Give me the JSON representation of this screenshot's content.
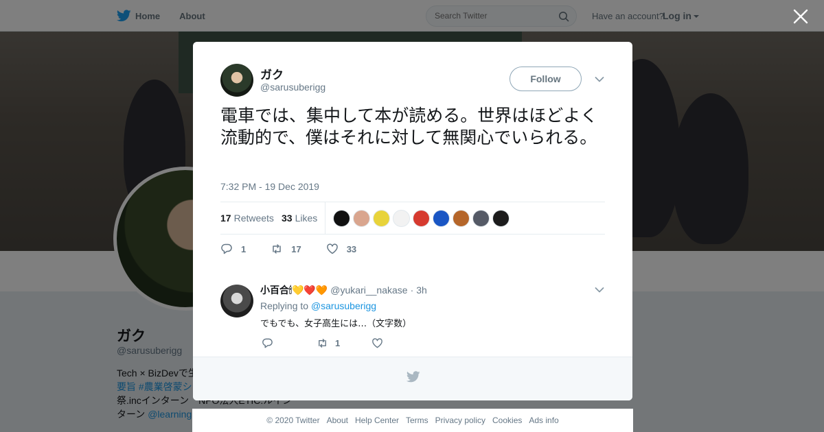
{
  "nav": {
    "home_label": "Home",
    "about_label": "About",
    "search_placeholder": "Search Twitter",
    "have_account": "Have an account?",
    "login_label": "Log in"
  },
  "profile": {
    "name": "ガク",
    "handle": "@sarusuberigg",
    "bio_line1": "Tech × BizDevで生",
    "bio_line2": "要旨 #農業啓蒙シ",
    "bio_line3": "祭.incインターン　NPO法人ETIC.ルイン",
    "bio_line4_a": "ターン ",
    "bio_line4_b": "@learning"
  },
  "tweet": {
    "author_name": "ガク",
    "author_handle": "@sarusuberigg",
    "follow_label": "Follow",
    "text": "電車では、集中して本が読める。世界はほどよく流動的で、僕はそれに対して無関心でいられる。",
    "timestamp": "7:32 PM - 19 Dec 2019",
    "retweets_count": "17",
    "retweets_label": "Retweets",
    "likes_count": "33",
    "likes_label": "Likes",
    "likers": [
      {
        "color": "#111111"
      },
      {
        "color": "#d9a58e"
      },
      {
        "color": "#e8d33a"
      },
      {
        "color": "#f2f2f2"
      },
      {
        "color": "#d63a2f"
      },
      {
        "color": "#1a56c4"
      },
      {
        "color": "#b5662a"
      },
      {
        "color": "#555a66"
      },
      {
        "color": "#1c1c1c"
      }
    ],
    "reply_count": "1",
    "retweet_count_action": "17",
    "like_count_action": "33"
  },
  "reply": {
    "name": "小百合🕯💛❤️🧡",
    "handle": "@yukari__nakase",
    "separator": "·",
    "time": "3h",
    "replying_prefix": "Replying to ",
    "replying_to": "@sarusuberigg",
    "text": "でもでも、女子高生には…（文字数）",
    "retweet_count": "1"
  },
  "footer": {
    "copyright": "© 2020 Twitter",
    "about": "About",
    "help": "Help Center",
    "terms": "Terms",
    "privacy": "Privacy policy",
    "cookies": "Cookies",
    "ads": "Ads info"
  },
  "colors": {
    "brand": "#1da1f2",
    "link": "#1b95e0",
    "muted": "#657786"
  }
}
